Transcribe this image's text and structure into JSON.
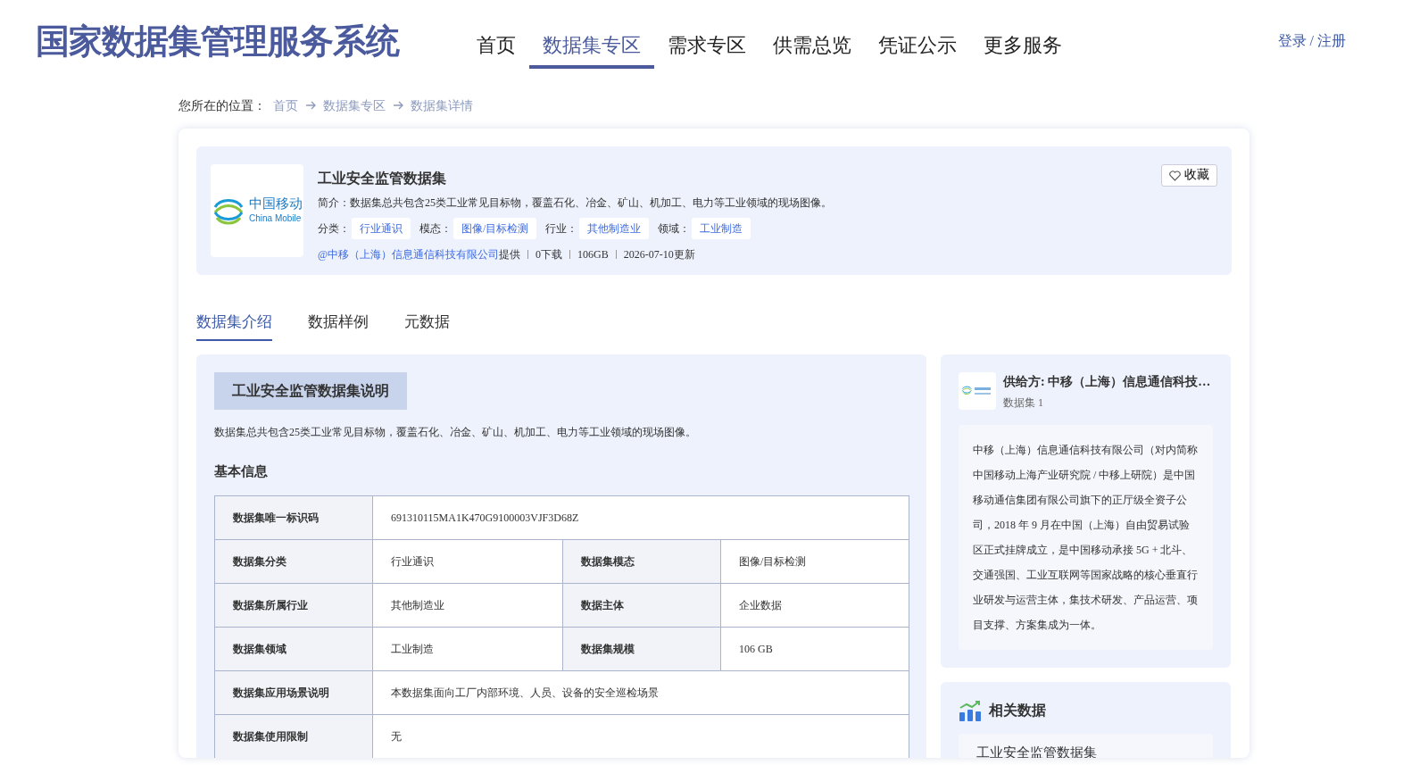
{
  "header": {
    "title": "国家数据集管理服务系统",
    "nav": [
      {
        "label": "首页",
        "selected": false
      },
      {
        "label": "数据集专区",
        "selected": true
      },
      {
        "label": "需求专区",
        "selected": false
      },
      {
        "label": "供需总览",
        "selected": false
      },
      {
        "label": "凭证公示",
        "selected": false
      },
      {
        "label": "更多服务",
        "selected": false
      }
    ],
    "login": "登录 / 注册"
  },
  "breadcrumb": {
    "prefix": "您所在的位置：",
    "items": [
      "首页",
      "数据集专区",
      "数据集详情"
    ]
  },
  "dataset": {
    "logo": {
      "name_cn": "中国移动",
      "name_en": "China Mobile"
    },
    "title": "工业安全监管数据集",
    "summary": "简介：数据集总共包含25类工业常见目标物，覆盖石化、冶金、矿山、机加工、电力等工业领域的现场图像。",
    "tags": [
      {
        "label": "分类：",
        "value": "行业通识"
      },
      {
        "label": "模态：",
        "value": "图像/目标检测"
      },
      {
        "label": "行业：",
        "value": "其他制造业"
      },
      {
        "label": "领域：",
        "value": "工业制造"
      }
    ],
    "provider": "@中移（上海）信息通信科技有限公司",
    "provided": "提供",
    "stats": [
      "0下载",
      "106GB",
      "2026-07-10更新"
    ],
    "favorite": {
      "label": "收藏",
      "on": false
    }
  },
  "tabs": [
    {
      "label": "数据集介绍",
      "selected": true
    },
    {
      "label": "数据样例",
      "selected": false
    },
    {
      "label": "元数据",
      "selected": false
    }
  ],
  "intro": {
    "heading": "工业安全监管数据集说明",
    "text": "数据集总共包含25类工业常见目标物，覆盖石化、冶金、矿山、机加工、电力等工业领域的现场图像。",
    "section": "基本信息",
    "rows": [
      {
        "cells": [
          {
            "text": "数据集唯一标识码",
            "header": true
          },
          {
            "text": "691310115MA1K470G9100003VJF3D68Z",
            "colspan": 3
          }
        ]
      },
      {
        "cells": [
          {
            "text": "数据集分类",
            "header": true
          },
          {
            "text": "行业通识"
          },
          {
            "text": "数据集模态",
            "header": true
          },
          {
            "text": "图像/目标检测"
          }
        ]
      },
      {
        "cells": [
          {
            "text": "数据集所属行业",
            "header": true
          },
          {
            "text": "其他制造业"
          },
          {
            "text": "数据主体",
            "header": true
          },
          {
            "text": "企业数据"
          }
        ]
      },
      {
        "cells": [
          {
            "text": "数据集领域",
            "header": true
          },
          {
            "text": "工业制造"
          },
          {
            "text": "数据集规模",
            "header": true
          },
          {
            "text": "106 GB"
          }
        ]
      },
      {
        "cells": [
          {
            "text": "数据集应用场景说明",
            "header": true
          },
          {
            "text": "本数据集面向工厂内部环境、人员、设备的安全巡检场景",
            "colspan": 3
          }
        ]
      },
      {
        "cells": [
          {
            "text": "数据集使用限制",
            "header": true
          },
          {
            "text": "无",
            "colspan": 3
          }
        ]
      }
    ]
  },
  "supplier": {
    "name": "供给方: 中移（上海）信息通信科技…",
    "count": "数据集 1",
    "description": "中移（上海）信息通信科技有限公司（对内简称中国移动上海产业研究院 / 中移上研院）是中国移动通信集团有限公司旗下的正厅级全资子公司，2018 年 9 月在中国（上海）自由贸易试验区正式挂牌成立，是中国移动承接 5G + 北斗、交通强国、工业互联网等国家战略的核心垂直行业研发与运营主体，集技术研发、产品运营、项目支撑、方案集成为一体。"
  },
  "related": {
    "title": "相关数据",
    "items": [
      "工业安全监管数据集"
    ]
  }
}
